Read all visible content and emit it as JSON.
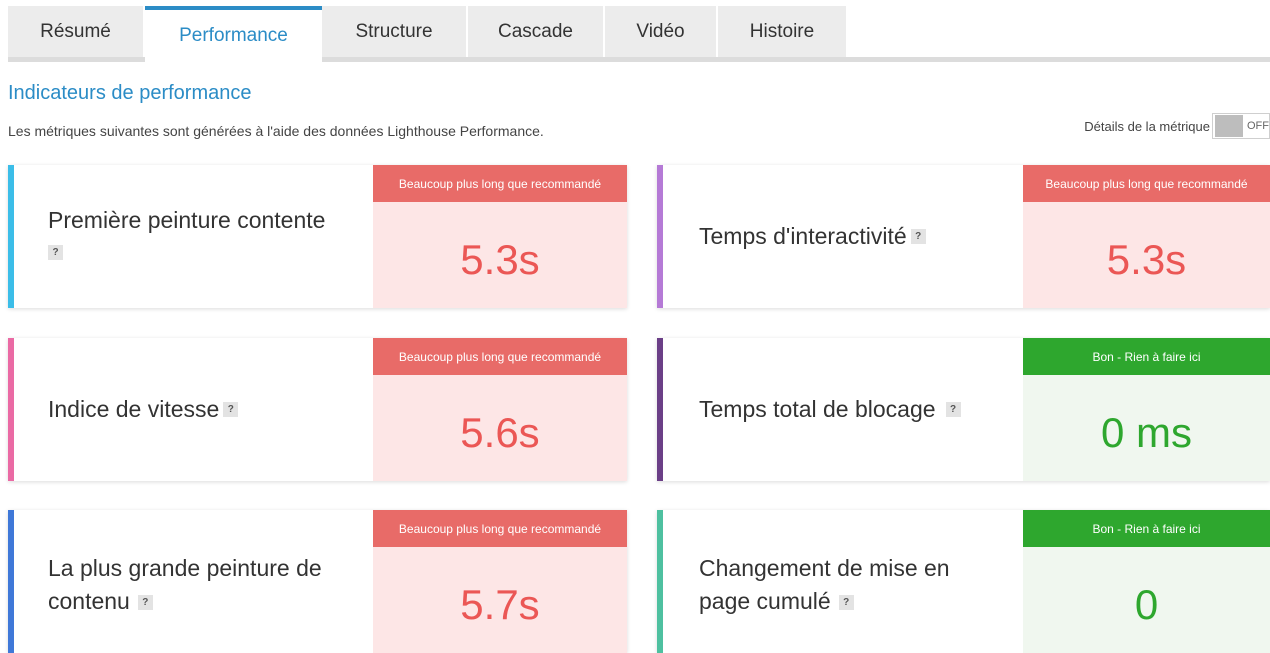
{
  "tabs": [
    {
      "label": "Résumé",
      "active": false
    },
    {
      "label": "Performance",
      "active": true
    },
    {
      "label": "Structure",
      "active": false
    },
    {
      "label": "Cascade",
      "active": false
    },
    {
      "label": "Vidéo",
      "active": false
    },
    {
      "label": "Histoire",
      "active": false
    }
  ],
  "section": {
    "title": "Indicateurs de performance",
    "subtitle": "Les métriques suivantes sont générées à l'aide des données Lighthouse Performance."
  },
  "details_toggle": {
    "label": "Détails de la métrique",
    "state": "OFF"
  },
  "help_glyph": "?",
  "colors": {
    "accent": "#2b8cc6",
    "bad_header": "#e86b68",
    "bad_bg": "#fde6e6",
    "bad_value": "#eb5755",
    "good_header": "#2ea72e",
    "good_bg": "#f0f7ef"
  },
  "metrics": [
    {
      "label": "Première peinture contente",
      "status": "Beaucoup plus long que recommandé",
      "value": "5.3s",
      "rating": "bad",
      "stripe_color": "#3bbde8"
    },
    {
      "label": "Temps d'interactivité",
      "status": "Beaucoup plus long que recommandé",
      "value": "5.3s",
      "rating": "bad",
      "stripe_color": "#b57ad6"
    },
    {
      "label": "Indice de vitesse",
      "status": "Beaucoup plus long que recommandé",
      "value": "5.6s",
      "rating": "bad",
      "stripe_color": "#ea6aa4"
    },
    {
      "label": "Temps total de blocage",
      "status": "Bon - Rien à faire ici",
      "value": "0 ms",
      "rating": "good",
      "stripe_color": "#6b3f87"
    },
    {
      "label": "La plus grande peinture de contenu",
      "status": "Beaucoup plus long que recommandé",
      "value": "5.7s",
      "rating": "bad",
      "stripe_color": "#3f78d8"
    },
    {
      "label": "Changement de mise en page cumulé",
      "status": "Bon - Rien à faire ici",
      "value": "0",
      "rating": "good",
      "stripe_color": "#4ec0a0"
    }
  ]
}
